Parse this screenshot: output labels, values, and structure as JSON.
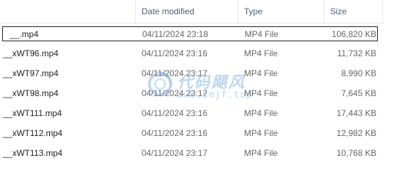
{
  "columns": {
    "date": "Date modified",
    "type": "Type",
    "size": "Size"
  },
  "files": [
    {
      "name": "__.mp4",
      "date": "04/11/2024 23:18",
      "type": "MP4 File",
      "size": "106,820 KB",
      "selected": true
    },
    {
      "name": "__xWT96.mp4",
      "date": "04/11/2024 23:16",
      "type": "MP4 File",
      "size": "11,732 KB"
    },
    {
      "name": "__xWT97.mp4",
      "date": "04/11/2024 23:17",
      "type": "MP4 File",
      "size": "8,990 KB"
    },
    {
      "name": "__xWT98.mp4",
      "date": "04/11/2024 23:17",
      "type": "MP4 File",
      "size": "7,645 KB"
    },
    {
      "name": "__xWT111.mp4",
      "date": "04/11/2024 23:16",
      "type": "MP4 File",
      "size": "17,443 KB"
    },
    {
      "name": "__xWT112.mp4",
      "date": "04/11/2024 23:16",
      "type": "MP4 File",
      "size": "12,982 KB"
    },
    {
      "name": "__xWT113.mp4",
      "date": "04/11/2024 23:17",
      "type": "MP4 File",
      "size": "10,768 KB"
    }
  ],
  "watermark": {
    "text": "代码飓风",
    "url": "www.dmjf.top",
    "color": "#6fa8dc"
  }
}
